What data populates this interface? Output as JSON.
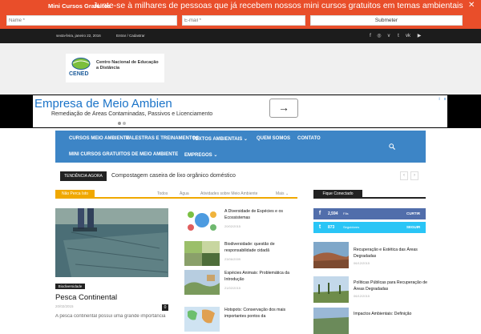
{
  "topbar": {
    "title": "Mini Cursos Gratuitos",
    "message": "Junte-se à milhares de pessoas que já recebem nossos mini cursos gratuitos em temas ambientais",
    "name_placeholder": "Name *",
    "email_placeholder": "E-mail *",
    "submit_label": "Submeter",
    "close_label": "✕"
  },
  "darkbar": {
    "date": "sexta-feira, janeiro 22, 2016",
    "login": "Entrar / Cadastrar",
    "social_icons": [
      "facebook-icon",
      "instagram-icon",
      "vimeo-icon",
      "twitter-icon",
      "vk-icon",
      "youtube-icon"
    ]
  },
  "logo": {
    "text": "Centro Nacional de Educação a Distância",
    "short": "CENED"
  },
  "ad": {
    "title": "Empresa de Meio Ambien",
    "subtitle": "Remediação de Áreas Contaminadas, Passivos e Licenciamento"
  },
  "nav": {
    "items": [
      {
        "label": "CURSOS MEIO AMBIENTE",
        "dropdown": false
      },
      {
        "label": "PALESTRAS E TREINAMENTOS",
        "dropdown": false
      },
      {
        "label": "TEXTOS AMBIENTAIS",
        "dropdown": true
      },
      {
        "label": "QUEM SOMOS",
        "dropdown": false
      },
      {
        "label": "CONTATO",
        "dropdown": false
      },
      {
        "label": "MINI CURSOS GRATUITOS DE MEIO AMBIENTE",
        "dropdown": false
      },
      {
        "label": "EMPREGOS",
        "dropdown": true
      }
    ],
    "dropdown_glyph": "⌄"
  },
  "trending": {
    "label": "TENDÊNCIA AGORA",
    "text": "Compostagem caseira de lixo orgânico doméstico",
    "prev": "‹",
    "next": "›"
  },
  "block": {
    "title": "Não Perca Isto",
    "filters": [
      "Todos",
      "Água",
      "Atividades sobre Meio Ambiente",
      "Mais"
    ],
    "more_glyph": "⌄"
  },
  "main_article": {
    "category": "Biodiversidade",
    "title": "Pesca Continental",
    "date": "20/02/2015",
    "comments": "0",
    "excerpt": "A pesca continental possui uma grande importância"
  },
  "articles": [
    {
      "title": "A Diversidade de Espécies e os Ecossistemas",
      "date": "20/02/2015"
    },
    {
      "title": "Biodiversidade: questão de responsabilidade cidadã",
      "date": "23/06/2009"
    },
    {
      "title": "Espécies Animais: Problemática da Introdução",
      "date": "21/02/2015"
    },
    {
      "title": "Hotspots: Conservação dos mais importantes pontos da",
      "date": ""
    }
  ],
  "sidebar": {
    "title": "Fique Conectado",
    "social": [
      {
        "icon": "facebook-icon",
        "glyph": "f",
        "count": "2,594",
        "label": "Fãs",
        "action": "CURTIR",
        "color": "#516eab"
      },
      {
        "icon": "twitter-icon",
        "glyph": "t",
        "count": "873",
        "label": "Seguidores",
        "action": "SEGUIR",
        "color": "#29c5f6"
      }
    ],
    "articles": [
      {
        "title": "Recuperação e Estética das Áreas Degradadas",
        "date": "06/12/2015"
      },
      {
        "title": "Políticas Públicas para Recuperação de Áreas Degradadas",
        "date": "06/12/2015"
      },
      {
        "title": "Impactos Ambientais: Definição",
        "date": ""
      }
    ]
  },
  "colors": {
    "topbar": "#e94e2a",
    "nav": "#3d85c6",
    "accent": "#f0a800",
    "dark": "#222222"
  }
}
